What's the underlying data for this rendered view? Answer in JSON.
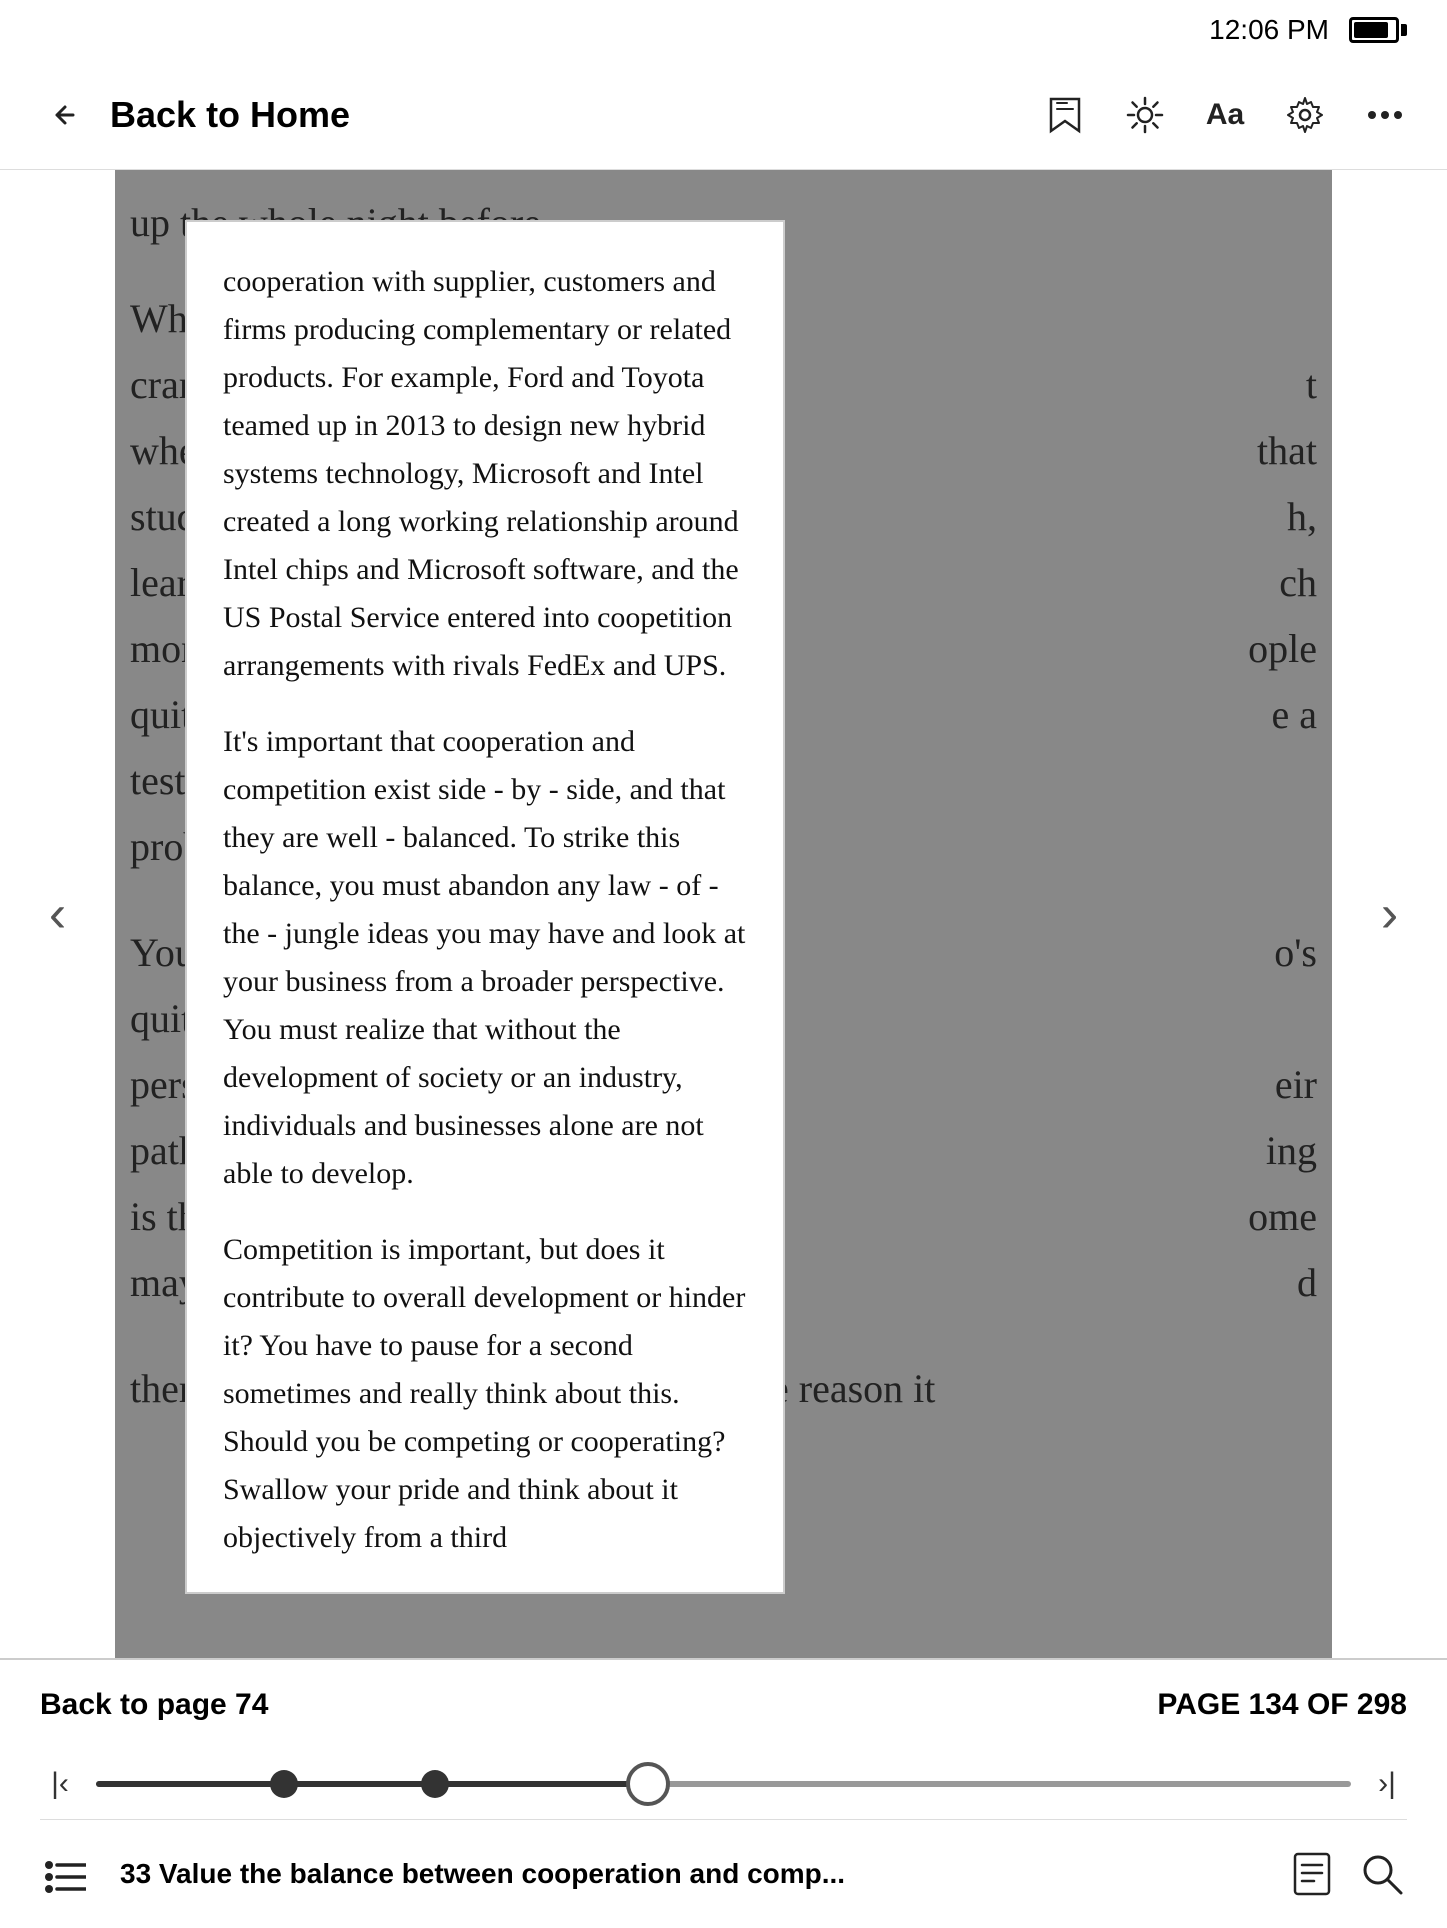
{
  "statusBar": {
    "time": "12:06 PM"
  },
  "topNav": {
    "backLabel": "Back to Home",
    "icons": {
      "bookmark": "🏷",
      "brightness": "☀",
      "font": "Aa",
      "settings": "⚙",
      "more": "•••"
    }
  },
  "readingArea": {
    "bgTextTop": "up the whole night before.",
    "bgLines": [
      "Whe",
      "cram",
      "wher",
      "study",
      "learn",
      "more",
      "quit s",
      "test e",
      "prob",
      "",
      "You'd",
      "quit t",
      "perso",
      "path",
      "is the",
      "may",
      "",
      "them at all in their working lives. But the reason it"
    ],
    "bgRightParts": [
      "",
      "t",
      "that",
      "h,",
      "ch",
      "ople",
      "e a",
      "",
      "",
      "",
      "o's",
      "",
      "eir",
      "ing",
      "ome",
      "d",
      "",
      ""
    ]
  },
  "popup": {
    "paragraphs": [
      "cooperation with supplier, customers and firms producing complementary or related products. For example, Ford and Toyota teamed up in 2013 to design new hybrid systems technology, Microsoft and Intel created a long working relationship around Intel chips and Microsoft software, and the US Postal Service entered into coopetition arrangements with rivals FedEx and UPS.",
      "It's important that cooperation and competition exist side - by - side, and that they are well - balanced. To strike this balance, you must abandon any law - of - the - jungle ideas you may have and look at your business from a broader perspective. You must realize that without the development of society or an industry, individuals and businesses alone are not able to develop.",
      "Competition is important, but does it contribute to overall development or hinder it? You have to pause for a second sometimes and really think about this. Should you be competing or cooperating? Swallow your pride and think about it objectively from a third"
    ]
  },
  "bottomBar": {
    "backToPage": "Back to page 74",
    "pageInfo": "PAGE 134 OF 298",
    "chapterTitle": "33 Value the balance between cooperation and comp...",
    "progress": {
      "position": 44
    }
  },
  "pageNav": {
    "leftArrow": "‹",
    "rightArrow": "›",
    "firstPage": "|‹",
    "lastPage": "›|"
  }
}
